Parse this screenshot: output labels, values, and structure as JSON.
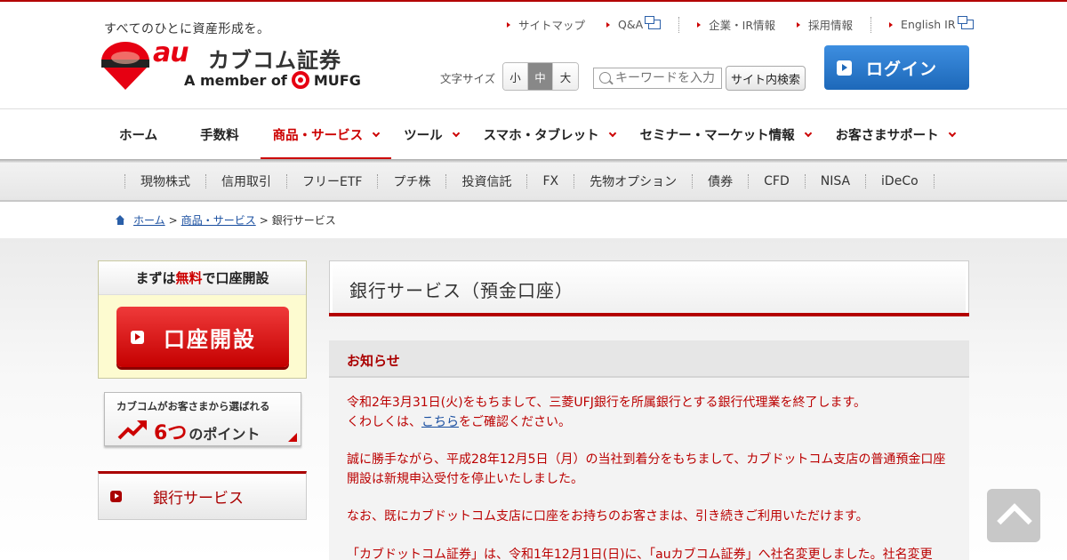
{
  "header": {
    "tagline": "すべてのひとに資産形成を。",
    "logo_au": "au",
    "logo_name": "カブコム証券",
    "logo_member": "A member of",
    "logo_mufg": "MUFG",
    "util_links": [
      {
        "label": "サイトマップ"
      },
      {
        "label": "Q&A"
      },
      {
        "label": "企業・IR情報"
      },
      {
        "label": "採用情報"
      },
      {
        "label": "English IR"
      }
    ],
    "fontsize_label": "文字サイズ",
    "fontsize_options": [
      "小",
      "中",
      "大"
    ],
    "fontsize_selected": "中",
    "search_placeholder": "キーワードを入力",
    "search_button": "サイト内検索",
    "login_label": "ログイン"
  },
  "global_nav": [
    {
      "label": "ホーム",
      "has_menu": false
    },
    {
      "label": "手数料",
      "has_menu": false
    },
    {
      "label": "商品・サービス",
      "has_menu": true,
      "active": true
    },
    {
      "label": "ツール",
      "has_menu": true
    },
    {
      "label": "スマホ・タブレット",
      "has_menu": true
    },
    {
      "label": "セミナー・マーケット情報",
      "has_menu": true
    },
    {
      "label": "お客さまサポート",
      "has_menu": true
    }
  ],
  "sub_nav": [
    "現物株式",
    "信用取引",
    "フリーETF",
    "プチ株",
    "投資信託",
    "FX",
    "先物オプション",
    "債券",
    "CFD",
    "NISA",
    "iDeCo"
  ],
  "breadcrumb": {
    "home": "ホーム",
    "section": "商品・サービス",
    "current": "銀行サービス"
  },
  "sidebar": {
    "open_title_pre": "まずは",
    "open_title_free": "無料",
    "open_title_post": "で口座開設",
    "open_button": "口座開設",
    "points_line1": "カブコムがお客さまから選ばれる",
    "points_num": "6つ",
    "points_rest": "のポイント",
    "nav_item": "銀行サービス"
  },
  "content": {
    "page_title": "銀行サービス（預金口座）",
    "notice_title": "お知らせ",
    "p1_line1": "令和2年3月31日(火)をもちまして、三菱UFJ銀行を所属銀行とする銀行代理業を終了します。",
    "p1_line2_pre": "くわしくは、",
    "p1_link": "こちら",
    "p1_line2_post": "をご確認ください。",
    "p2": "誠に勝手ながら、平成28年12月5日（月）の当社到着分をもちまして、カブドットコム支店の普通預金口座開設は新規申込受付を停止いたしました。",
    "p3": "なお、既にカブドットコム支店に口座をお持ちのお客さまは、引き続きご利用いただけます。",
    "p4": "「カブドットコム証券」は、令和1年12月1日(日)に、「auカブコム証券」へ社名変更しました。社名変更"
  },
  "colors": {
    "brand_red": "#c00000",
    "login_blue": "#1d68b9",
    "notice_text": "#b00000"
  }
}
